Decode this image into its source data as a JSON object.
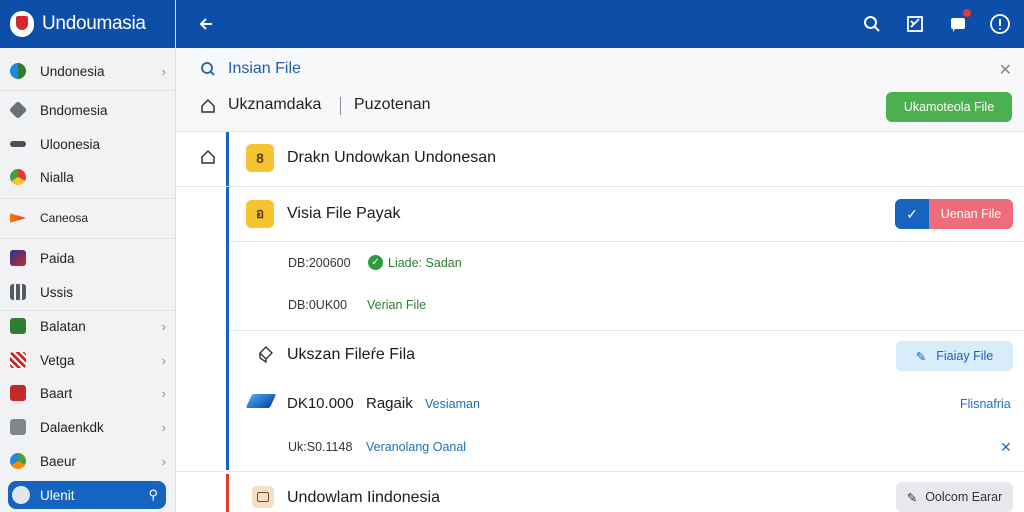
{
  "app": {
    "brand": "Undoumasia",
    "colors": {
      "topbar": "#0d4fa8",
      "accent_blue": "#1565c0",
      "green": "#4caf50",
      "red": "#e53935"
    }
  },
  "topbar": {
    "icons": [
      "back-arrow-icon",
      "search-icon",
      "checklist-icon",
      "notification-icon",
      "help-icon"
    ]
  },
  "sidebar": {
    "items": [
      {
        "label": "Undonesia",
        "icon": "globe-icon",
        "chevron": true
      },
      {
        "label": "Bndomesia",
        "icon": "puzzle-icon",
        "chevron": false
      },
      {
        "label": "Uloonesia",
        "icon": "dash-icon",
        "chevron": false
      },
      {
        "label": "Nialla",
        "icon": "chrome-icon",
        "chevron": false
      },
      {
        "label": "Caneosa",
        "icon": "arrow-flag-icon",
        "chevron": false
      },
      {
        "label": "Paida",
        "icon": "book-icon",
        "chevron": false
      },
      {
        "label": "Ussis",
        "icon": "grid-icon",
        "chevron": false
      },
      {
        "label": "Balatan",
        "icon": "green-doc-icon",
        "chevron": true
      },
      {
        "label": "Vetga",
        "icon": "cross-flag-icon",
        "chevron": true
      },
      {
        "label": "Baart",
        "icon": "red-doc-icon",
        "chevron": true
      },
      {
        "label": "Dalaenkdk",
        "icon": "clipboard-icon",
        "chevron": true
      },
      {
        "label": "Baeur",
        "icon": "palette-icon",
        "chevron": true
      },
      {
        "label": "Ulenit",
        "icon": "user-icon",
        "chevron": true
      }
    ]
  },
  "panel": {
    "search_label": "Insian File",
    "home_label": "Ukznamdaka",
    "breadcrumb_right": "Puzotenan",
    "primary_button": "Ukamoteola File"
  },
  "rows": {
    "r1": {
      "title": "Drakn Undowkan Undonesan",
      "badge": "8"
    },
    "r2": {
      "title": "Visia File Payak",
      "badge": "อ",
      "toggle_label": "Uenan File",
      "detail1_code": "DB:200600",
      "detail1_status": "Liade: Sadan",
      "detail2_code": "DB:0UK00",
      "detail2_link": "Verian File"
    },
    "r3": {
      "title": "Ukszan Fileŕe Fila",
      "button": "Fiaiay File",
      "detail1_code": "DK10.000",
      "detail1_text": "Ragaik",
      "detail1_link": "Vesiaman",
      "detail1_right": "Flisnafria",
      "detail2_code": "Uk:S0.1148",
      "detail2_link": "Veranolang Oanal"
    },
    "r4": {
      "title": "Undowlam Iindonesia",
      "button": "Oolcom Earar"
    }
  }
}
